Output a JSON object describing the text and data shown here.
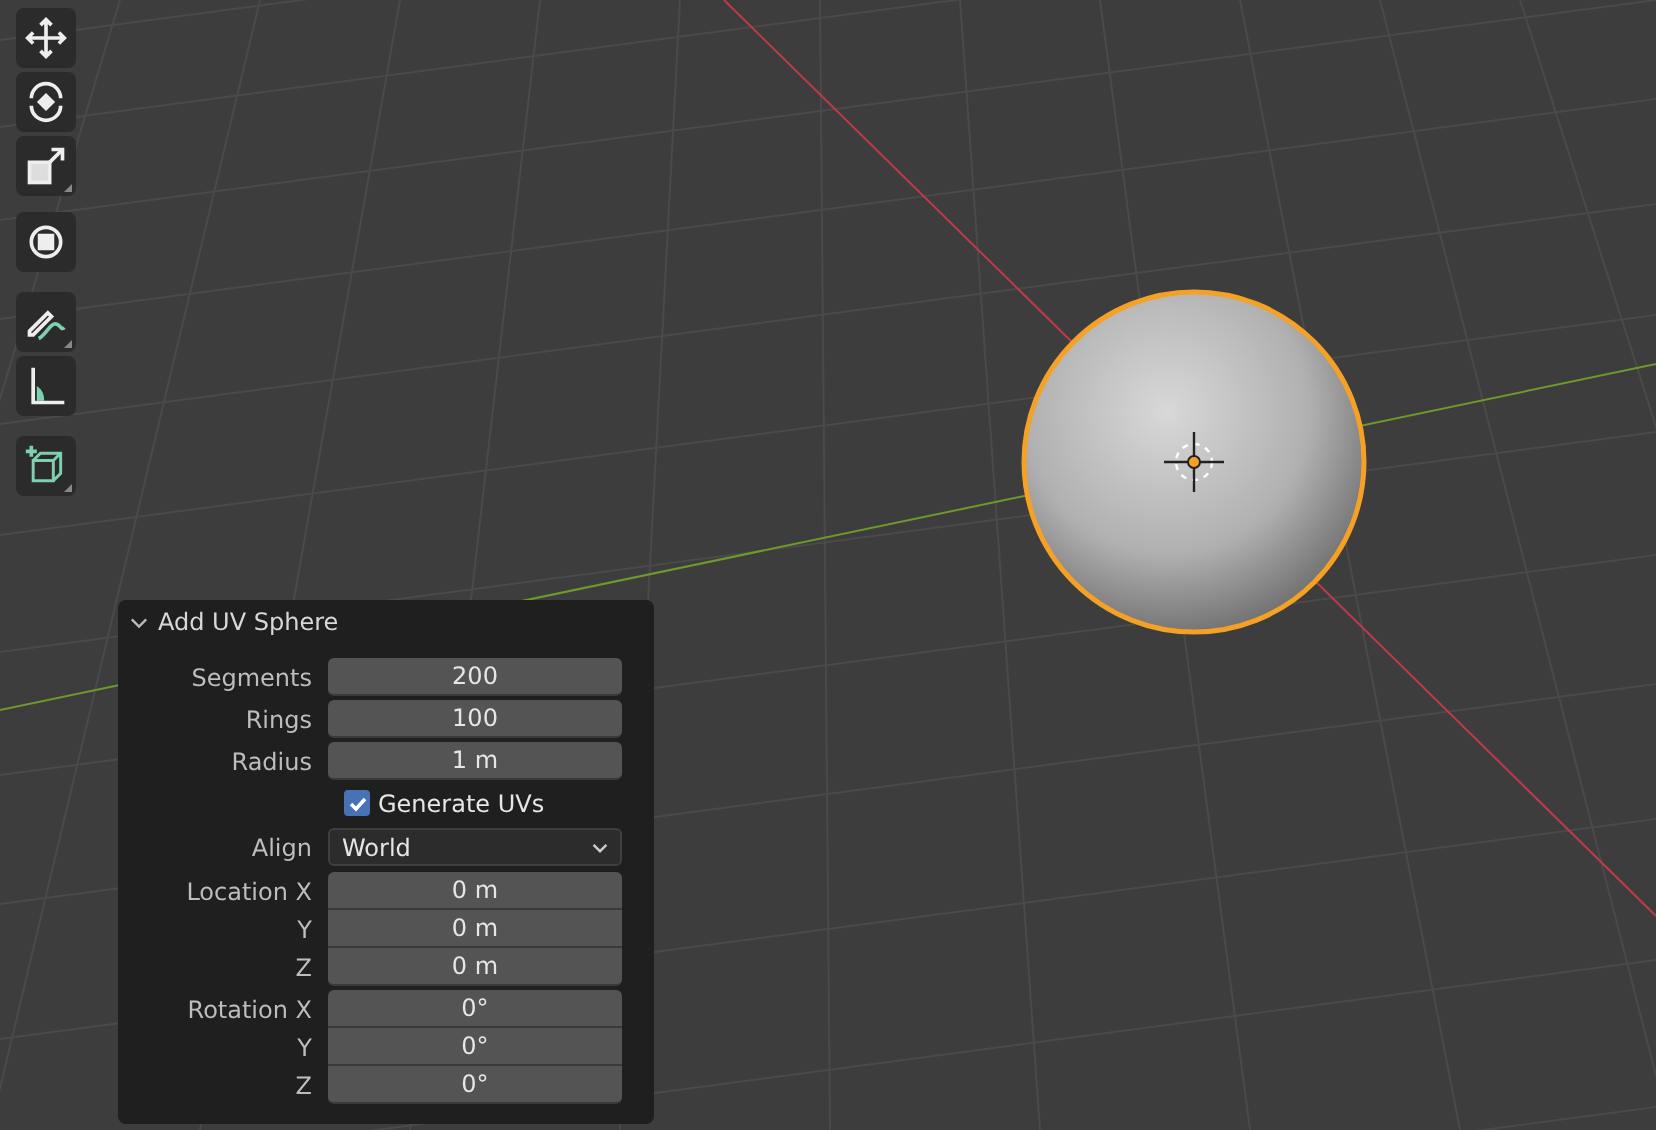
{
  "operator_panel": {
    "title": "Add UV Sphere",
    "expanded": true,
    "fields": [
      {
        "kind": "group",
        "rows": [
          {
            "label": "Segments",
            "value": "200"
          }
        ]
      },
      {
        "kind": "group",
        "rows": [
          {
            "label": "Rings",
            "value": "100"
          }
        ]
      },
      {
        "kind": "group",
        "rows": [
          {
            "label": "Radius",
            "value": "1 m"
          }
        ]
      },
      {
        "kind": "checkbox",
        "label": "Generate UVs",
        "checked": true
      },
      {
        "kind": "dropdown",
        "label": "Align",
        "value": "World"
      },
      {
        "kind": "group",
        "rows": [
          {
            "label": "Location X",
            "value": "0 m"
          },
          {
            "label": "Y",
            "value": "0 m"
          },
          {
            "label": "Z",
            "value": "0 m"
          }
        ]
      },
      {
        "kind": "group",
        "rows": [
          {
            "label": "Rotation X",
            "value": "0°"
          },
          {
            "label": "Y",
            "value": "0°"
          },
          {
            "label": "Z",
            "value": "0°"
          }
        ]
      }
    ]
  }
}
